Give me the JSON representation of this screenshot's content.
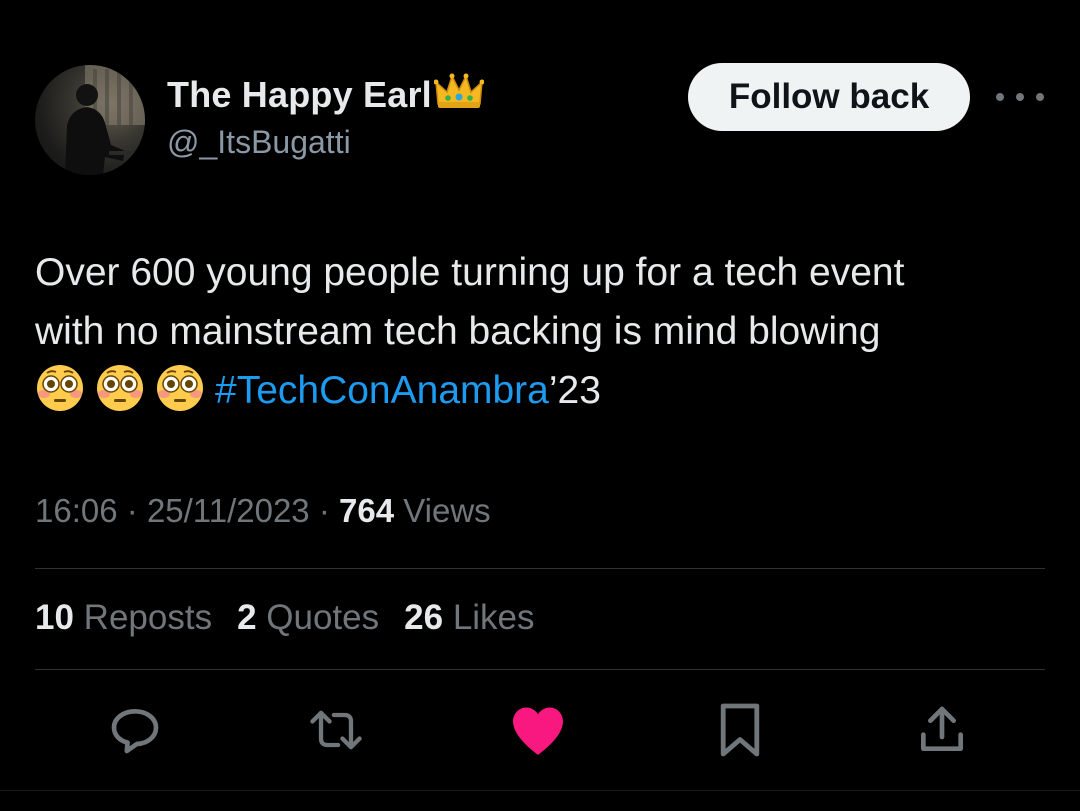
{
  "author": {
    "display_name": "The Happy Earl",
    "handle": "@_ItsBugatti",
    "badge_emoji": "crown-emoji"
  },
  "follow_button": {
    "label": "Follow back"
  },
  "more_button": {
    "icon": "more-dots-icon"
  },
  "tweet": {
    "line1": "Over 600 young people turning up for a tech event",
    "line2": "with no mainstream tech backing is mind blowing",
    "emojis": [
      "flushed-face-emoji",
      "flushed-face-emoji",
      "flushed-face-emoji"
    ],
    "hashtag": "#TechConAnambra",
    "suffix": "’23"
  },
  "meta": {
    "time": "16:06",
    "separator": "·",
    "date": "25/11/2023",
    "views_count": "764",
    "views_label": "Views"
  },
  "stats": {
    "reposts": {
      "count": "10",
      "label": "Reposts"
    },
    "quotes": {
      "count": "2",
      "label": "Quotes"
    },
    "likes": {
      "count": "26",
      "label": "Likes"
    }
  },
  "actions": {
    "reply": "reply-icon",
    "repost": "repost-icon",
    "like": "heart-icon",
    "bookmark": "bookmark-icon",
    "share": "share-icon"
  },
  "colors": {
    "background": "#000000",
    "text": "#e7e9ea",
    "muted": "#71767b",
    "link": "#1d9bf0",
    "liked": "#f91880",
    "divider": "#2f3336"
  }
}
